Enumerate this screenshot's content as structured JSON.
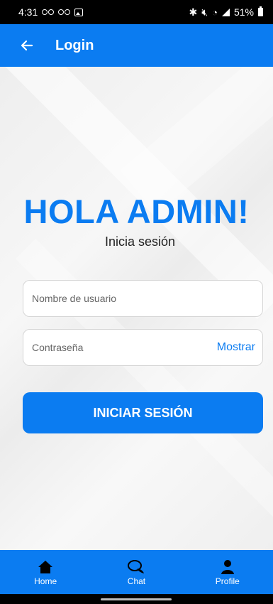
{
  "status_bar": {
    "time": "4:31",
    "battery": "51%"
  },
  "app_bar": {
    "title": "Login",
    "back_icon": "arrow-left-icon"
  },
  "login": {
    "greeting": "HOLA ADMIN!",
    "subtitle": "Inicia sesión",
    "username": {
      "placeholder": "Nombre de usuario",
      "value": ""
    },
    "password": {
      "placeholder": "Contraseña",
      "value": "",
      "toggle_label": "Mostrar"
    },
    "submit_label": "INICIAR SESIÓN"
  },
  "bottom_nav": {
    "items": [
      {
        "label": "Home",
        "icon": "home-icon"
      },
      {
        "label": "Chat",
        "icon": "chat-icon"
      },
      {
        "label": "Profile",
        "icon": "profile-icon"
      }
    ]
  },
  "colors": {
    "primary": "#0b7cf1",
    "background": "#f2f2f2"
  }
}
